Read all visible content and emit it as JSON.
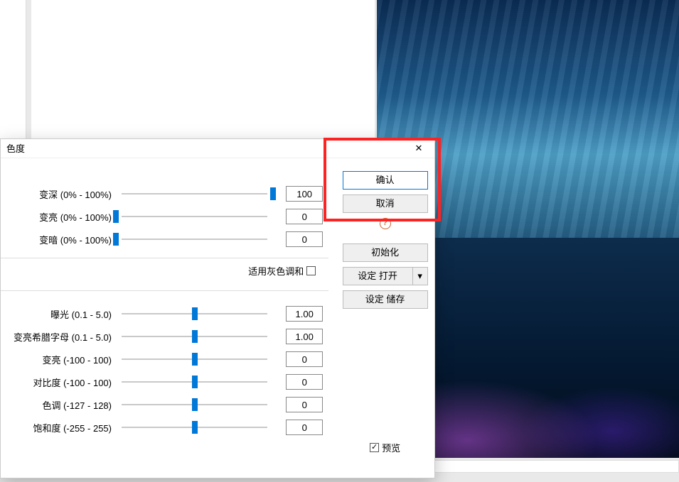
{
  "dialog": {
    "title": "色度",
    "close_aria": "关闭",
    "gray_sum_label": "适用灰色调和",
    "gray_sum_checked": false,
    "preview_label": "预览",
    "preview_checked": true
  },
  "sliders_top": [
    {
      "label": "变深 (0% - 100%)",
      "value": "100",
      "pos": 100
    },
    {
      "label": "变亮 (0% - 100%)",
      "value": "0",
      "pos": 0
    },
    {
      "label": "变暗 (0% - 100%)",
      "value": "0",
      "pos": 0
    }
  ],
  "sliders_bottom": [
    {
      "label": "曝光 (0.1 - 5.0)",
      "value": "1.00",
      "pos": 50
    },
    {
      "label": "变亮希腊字母 (0.1 - 5.0)",
      "value": "1.00",
      "pos": 50
    },
    {
      "label": "变亮 (-100 - 100)",
      "value": "0",
      "pos": 50
    },
    {
      "label": "对比度 (-100 - 100)",
      "value": "0",
      "pos": 50
    },
    {
      "label": "色调 (-127 - 128)",
      "value": "0",
      "pos": 50
    },
    {
      "label": "饱和度 (-255 - 255)",
      "value": "0",
      "pos": 50
    }
  ],
  "buttons": {
    "ok": "确认",
    "cancel": "取消",
    "reset": "初始化",
    "load_main": "设定 打开",
    "load_arrow": "▾",
    "save": "设定 储存"
  },
  "help_icon": "?"
}
